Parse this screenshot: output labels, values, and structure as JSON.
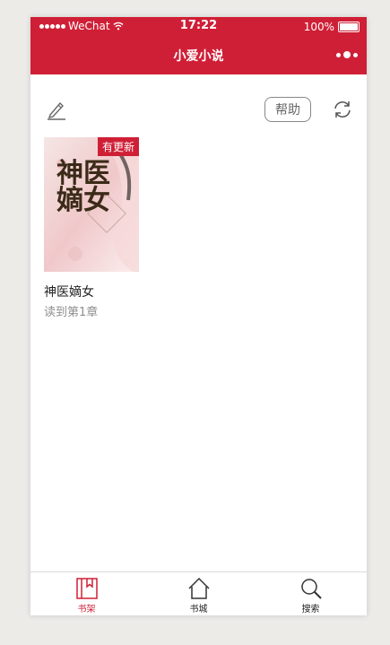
{
  "status_bar": {
    "carrier": "WeChat",
    "time": "17:22",
    "battery": "100%",
    "battery_level": 1.0
  },
  "nav": {
    "title": "小爱小说"
  },
  "toolbar": {
    "help_label": "帮助"
  },
  "shelf": {
    "books": [
      {
        "badge": "有更新",
        "cover_title": "神医嫡女",
        "title": "神医嫡女",
        "progress": "读到第1章"
      }
    ]
  },
  "tabbar": {
    "items": [
      {
        "label": "书架",
        "icon": "bookshelf-icon",
        "active": true
      },
      {
        "label": "书城",
        "icon": "home-icon",
        "active": false
      },
      {
        "label": "搜索",
        "icon": "search-icon",
        "active": false
      }
    ]
  },
  "colors": {
    "accent": "#cf1f36",
    "background": "#ecebe8"
  }
}
